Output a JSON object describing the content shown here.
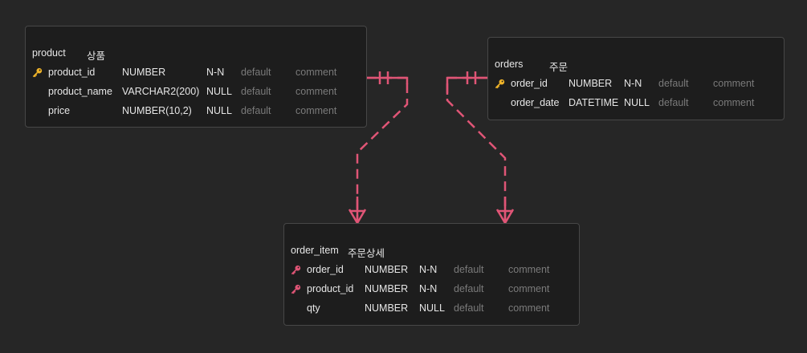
{
  "colors": {
    "background": "#262626",
    "table_bg": "#1d1d1d",
    "table_border": "#474747",
    "primary_key": "#f0b429",
    "foreign_key": "#e05576",
    "relation": "#e05576",
    "muted": "#7a7a7a"
  },
  "tables": {
    "product": {
      "name": "product",
      "comment": "상품",
      "columns": [
        {
          "name": "product_id",
          "type": "NUMBER",
          "nullable": "N-N",
          "default": "default",
          "comment": "comment",
          "key": "primary-key-icon"
        },
        {
          "name": "product_name",
          "type": "VARCHAR2(200)",
          "nullable": "NULL",
          "default": "default",
          "comment": "comment",
          "key": ""
        },
        {
          "name": "price",
          "type": "NUMBER(10,2)",
          "nullable": "NULL",
          "default": "default",
          "comment": "comment",
          "key": ""
        }
      ]
    },
    "orders": {
      "name": "orders",
      "comment": "주문",
      "columns": [
        {
          "name": "order_id",
          "type": "NUMBER",
          "nullable": "N-N",
          "default": "default",
          "comment": "comment",
          "key": "primary-key-icon"
        },
        {
          "name": "order_date",
          "type": "DATETIME",
          "nullable": "NULL",
          "default": "default",
          "comment": "comment",
          "key": ""
        }
      ]
    },
    "order_item": {
      "name": "order_item",
      "comment": "주문상세",
      "columns": [
        {
          "name": "order_id",
          "type": "NUMBER",
          "nullable": "N-N",
          "default": "default",
          "comment": "comment",
          "key": "foreign-key-icon"
        },
        {
          "name": "product_id",
          "type": "NUMBER",
          "nullable": "N-N",
          "default": "default",
          "comment": "comment",
          "key": "foreign-key-icon"
        },
        {
          "name": "qty",
          "type": "NUMBER",
          "nullable": "NULL",
          "default": "default",
          "comment": "comment",
          "key": ""
        }
      ]
    }
  },
  "relationships": [
    {
      "from": "product",
      "to": "order_item",
      "from_cardinality": "one-and-only-one",
      "to_cardinality": "one-or-many",
      "identifying": false
    },
    {
      "from": "orders",
      "to": "order_item",
      "from_cardinality": "one-and-only-one",
      "to_cardinality": "one-or-many",
      "identifying": false
    }
  ]
}
